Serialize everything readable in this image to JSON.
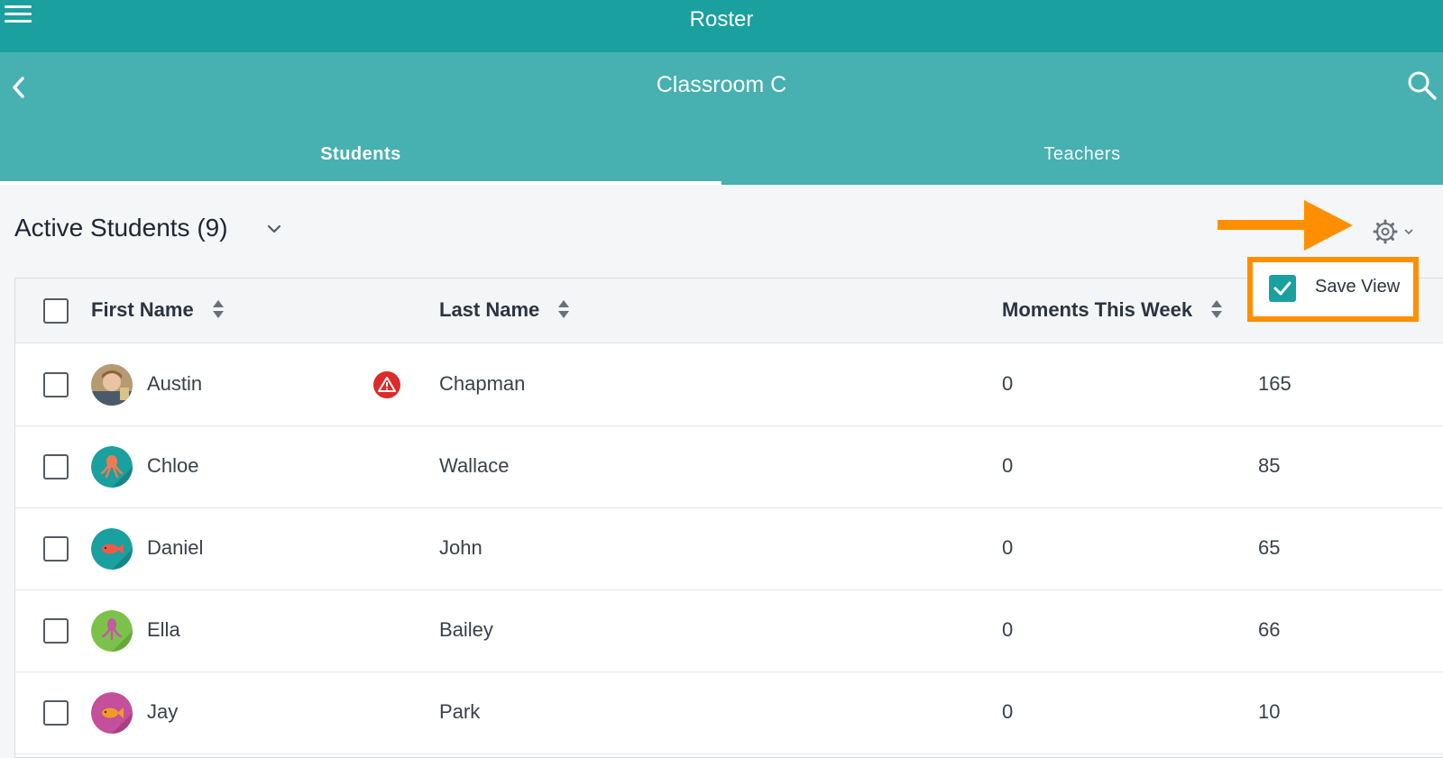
{
  "app": {
    "title": "Roster"
  },
  "header": {
    "title": "Classroom C"
  },
  "tabs": [
    {
      "label": "Students",
      "active": true
    },
    {
      "label": "Teachers",
      "active": false
    }
  ],
  "section": {
    "title": "Active Students (9)"
  },
  "save_view": {
    "label": "Save View",
    "checked": true
  },
  "table": {
    "columns": [
      "First Name",
      "Last Name",
      "Moments This Week"
    ],
    "rows": [
      {
        "first": "Austin",
        "last": "Chapman",
        "moments": "0",
        "value": "165",
        "warning": true,
        "avatar": "photo"
      },
      {
        "first": "Chloe",
        "last": "Wallace",
        "moments": "0",
        "value": "85",
        "warning": false,
        "avatar": "octopus-icon"
      },
      {
        "first": "Daniel",
        "last": "John",
        "moments": "0",
        "value": "65",
        "warning": false,
        "avatar": "fish-icon"
      },
      {
        "first": "Ella",
        "last": "Bailey",
        "moments": "0",
        "value": "66",
        "warning": false,
        "avatar": "squid-icon"
      },
      {
        "first": "Jay",
        "last": "Park",
        "moments": "0",
        "value": "10",
        "warning": false,
        "avatar": "fish-icon"
      }
    ]
  },
  "colors": {
    "topbar": "#1aa09f",
    "subbar": "#47b0b0",
    "highlight": "#ff8f00",
    "warning": "#dd2a2a"
  }
}
